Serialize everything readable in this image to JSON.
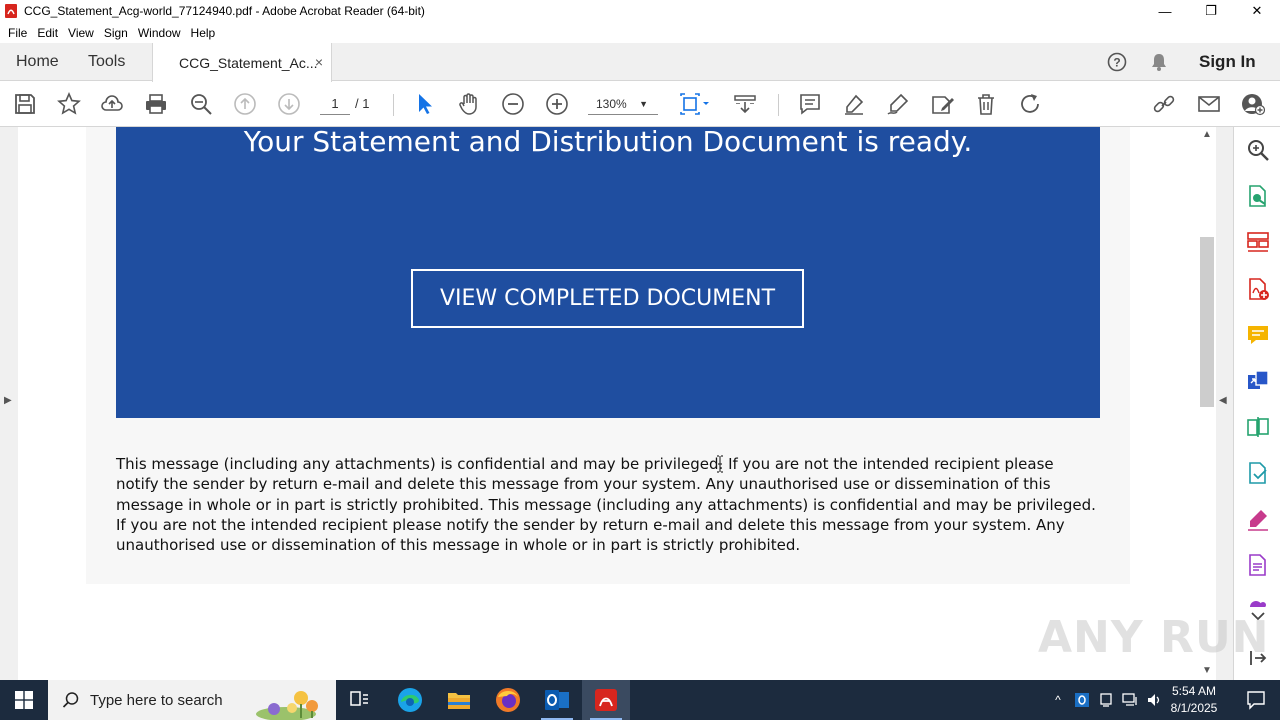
{
  "window": {
    "title": "CCG_Statement_Acg-world_77124940.pdf - Adobe Acrobat Reader (64-bit)",
    "minimize": "—",
    "maximize": "❐",
    "close": "✕"
  },
  "menu": [
    "File",
    "Edit",
    "View",
    "Sign",
    "Window",
    "Help"
  ],
  "tabs": {
    "home": "Home",
    "tools": "Tools",
    "document": "CCG_Statement_Ac...",
    "close": "×"
  },
  "header": {
    "sign_in": "Sign In"
  },
  "toolbar": {
    "page_current": "1",
    "page_total": "/ 1",
    "zoom": "130%",
    "zoom_caret": "▼"
  },
  "document": {
    "banner_title": "Your Statement and Distribution Document is ready.",
    "button_label": "VIEW COMPLETED DOCUMENT",
    "disclaimer": "This message (including any attachments) is confidential and may be privileged. If you are not the intended recipient please notify the sender by return e-mail and delete this message from your system. Any unauthorised use or dissemination of this message in whole or in part is strictly prohibited. This message (including any attachments) is confidential and may be privileged. If you are not the intended recipient please notify the sender by return e-mail and delete this message from your system. Any unauthorised use or dissemination of this message in whole or in part is strictly prohibited."
  },
  "watermark": "ANY RUN",
  "taskbar": {
    "search_placeholder": "Type here to search",
    "time": "5:54 AM",
    "date": "8/1/2025"
  },
  "colors": {
    "banner": "#1f4ea0",
    "taskbar": "#1c2b3e",
    "acrobat_red": "#d7261e",
    "tool_blue": "#1473e6"
  }
}
